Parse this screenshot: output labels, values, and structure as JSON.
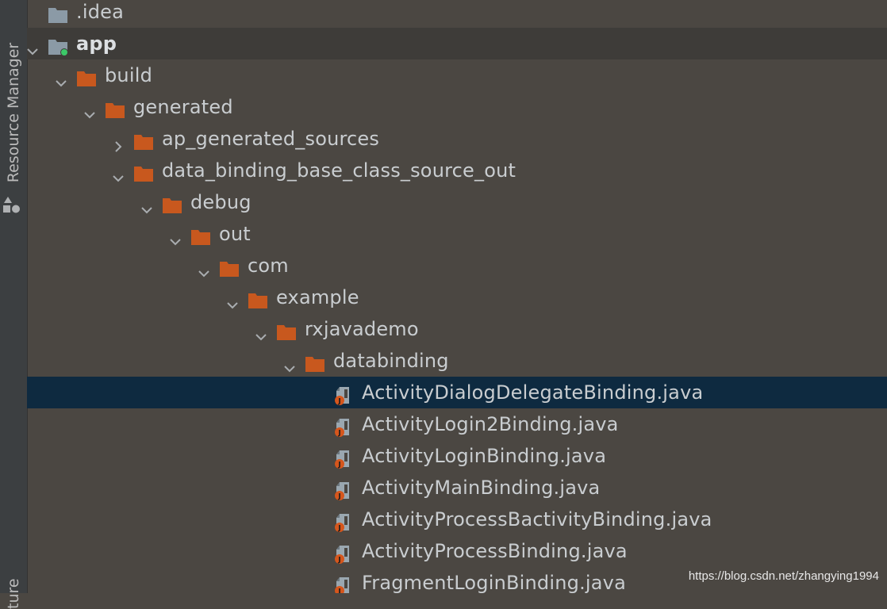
{
  "sidebar": {
    "top_label": "Resource Manager",
    "bottom_label": "ture"
  },
  "tree": {
    "rows": [
      {
        "label": ".idea",
        "depth": 0,
        "arrow": "none",
        "icon": "folder-gray"
      },
      {
        "label": "app",
        "depth": 0,
        "arrow": "down",
        "icon": "module-folder",
        "bold": true
      },
      {
        "label": "build",
        "depth": 1,
        "arrow": "down",
        "icon": "folder-orange"
      },
      {
        "label": "generated",
        "depth": 2,
        "arrow": "down",
        "icon": "folder-orange"
      },
      {
        "label": "ap_generated_sources",
        "depth": 3,
        "arrow": "right",
        "icon": "folder-orange"
      },
      {
        "label": "data_binding_base_class_source_out",
        "depth": 3,
        "arrow": "down",
        "icon": "folder-orange"
      },
      {
        "label": "debug",
        "depth": 4,
        "arrow": "down",
        "icon": "folder-orange"
      },
      {
        "label": "out",
        "depth": 5,
        "arrow": "down",
        "icon": "folder-orange"
      },
      {
        "label": "com",
        "depth": 6,
        "arrow": "down",
        "icon": "folder-orange"
      },
      {
        "label": "example",
        "depth": 7,
        "arrow": "down",
        "icon": "folder-orange"
      },
      {
        "label": "rxjavademo",
        "depth": 8,
        "arrow": "down",
        "icon": "folder-orange"
      },
      {
        "label": "databinding",
        "depth": 9,
        "arrow": "down",
        "icon": "folder-orange"
      },
      {
        "label": "ActivityDialogDelegateBinding.java",
        "depth": 10,
        "arrow": "none",
        "icon": "java-file",
        "selected": true
      },
      {
        "label": "ActivityLogin2Binding.java",
        "depth": 10,
        "arrow": "none",
        "icon": "java-file"
      },
      {
        "label": "ActivityLoginBinding.java",
        "depth": 10,
        "arrow": "none",
        "icon": "java-file"
      },
      {
        "label": "ActivityMainBinding.java",
        "depth": 10,
        "arrow": "none",
        "icon": "java-file"
      },
      {
        "label": "ActivityProcessBactivityBinding.java",
        "depth": 10,
        "arrow": "none",
        "icon": "java-file"
      },
      {
        "label": "ActivityProcessBinding.java",
        "depth": 10,
        "arrow": "none",
        "icon": "java-file"
      },
      {
        "label": "FragmentLoginBinding.java",
        "depth": 10,
        "arrow": "none",
        "icon": "java-file"
      },
      {
        "label": "",
        "depth": 3,
        "arrow": "right",
        "icon": "folder-orange"
      }
    ]
  },
  "watermark": "https://blog.csdn.net/zhangying1994",
  "colors": {
    "background": "#4b4742",
    "selection": "#0e2a40",
    "folder": "#c8581e",
    "text": "#c9cdd0",
    "module_dot": "#3cc868"
  }
}
